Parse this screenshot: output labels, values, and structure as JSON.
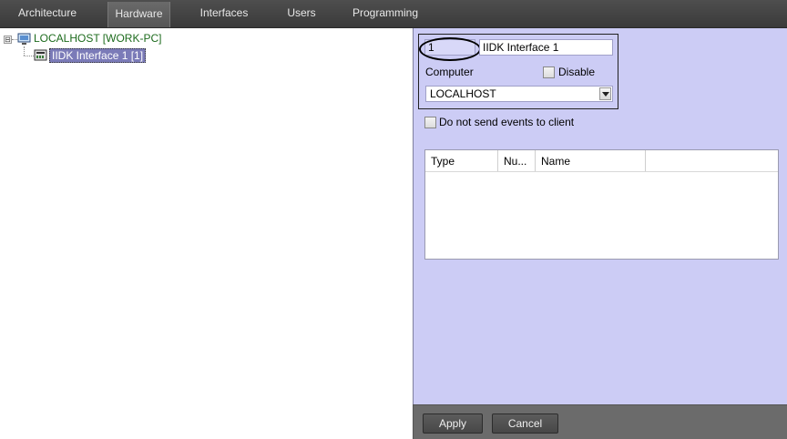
{
  "tabs": [
    {
      "label": "Architecture",
      "active": false
    },
    {
      "label": "Hardware",
      "active": true
    },
    {
      "label": "Interfaces",
      "active": false
    },
    {
      "label": "Users",
      "active": false
    },
    {
      "label": "Programming",
      "active": false
    }
  ],
  "tree": {
    "root": {
      "label": "LOCALHOST [WORK-PC]",
      "expander": "⊟",
      "icon": "monitor-icon"
    },
    "child": {
      "label": "IIDK Interface 1 [1]",
      "icon": "interface-module-icon"
    }
  },
  "settings": {
    "id_value": "1",
    "name_value": "IIDK Interface 1",
    "computer_label": "Computer",
    "disable_label": "Disable",
    "computer_value": "LOCALHOST"
  },
  "options": {
    "no_events_label": "Do not send events to client"
  },
  "grid": {
    "columns": [
      "Type",
      "Nu...",
      "Name"
    ]
  },
  "buttons": {
    "apply": "Apply",
    "cancel": "Cancel"
  },
  "colors": {
    "panel_bg": "#ccccf5",
    "selection_bg": "#7b7bb8",
    "tabbar_bg": "#444444"
  }
}
